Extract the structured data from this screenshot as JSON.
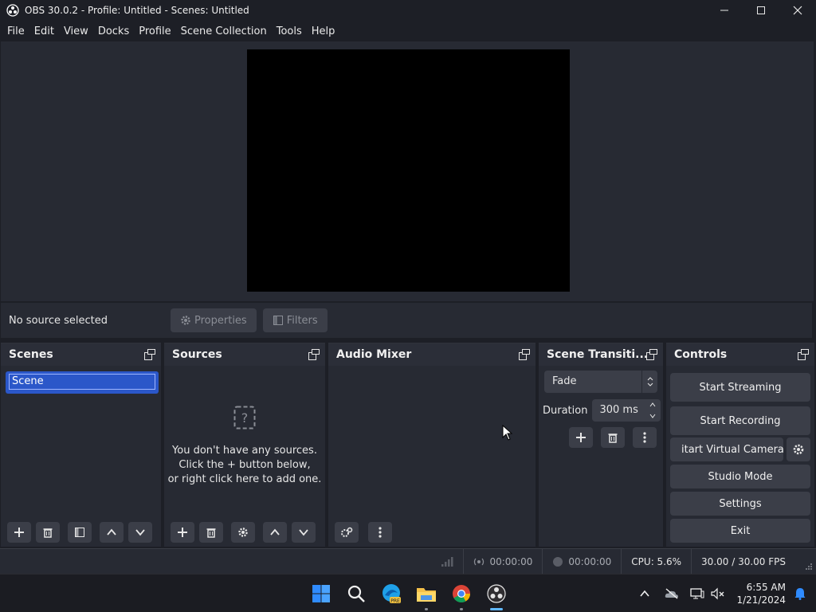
{
  "window": {
    "title": "OBS 30.0.2 - Profile: Untitled - Scenes: Untitled"
  },
  "menu": [
    "File",
    "Edit",
    "View",
    "Docks",
    "Profile",
    "Scene Collection",
    "Tools",
    "Help"
  ],
  "source_bar": {
    "status": "No source selected",
    "properties": "Properties",
    "filters": "Filters"
  },
  "docks": {
    "scenes": {
      "title": "Scenes",
      "items": [
        "Scene"
      ]
    },
    "sources": {
      "title": "Sources",
      "empty_line1": "You don't have any sources.",
      "empty_line2": "Click the + button below,",
      "empty_line3": "or right click here to add one."
    },
    "audio_mixer": {
      "title": "Audio Mixer"
    },
    "transitions": {
      "title": "Scene Transiti...",
      "selected": "Fade",
      "duration_label": "Duration",
      "duration_value": "300 ms"
    },
    "controls": {
      "title": "Controls",
      "start_streaming": "Start Streaming",
      "start_recording": "Start Recording",
      "start_virtual_camera": "itart Virtual Camera",
      "studio_mode": "Studio Mode",
      "settings": "Settings",
      "exit": "Exit"
    }
  },
  "status": {
    "stream_time": "00:00:00",
    "record_time": "00:00:00",
    "cpu": "CPU: 5.6%",
    "fps": "30.00 / 30.00 FPS"
  },
  "taskbar": {
    "time": "6:55 AM",
    "date": "1/21/2024"
  },
  "icons": {
    "start": "windows-start-icon",
    "search": "search-icon",
    "edge": "edge-dev-icon",
    "explorer": "folder-icon",
    "chrome": "chrome-icon",
    "obs": "obs-icon"
  }
}
